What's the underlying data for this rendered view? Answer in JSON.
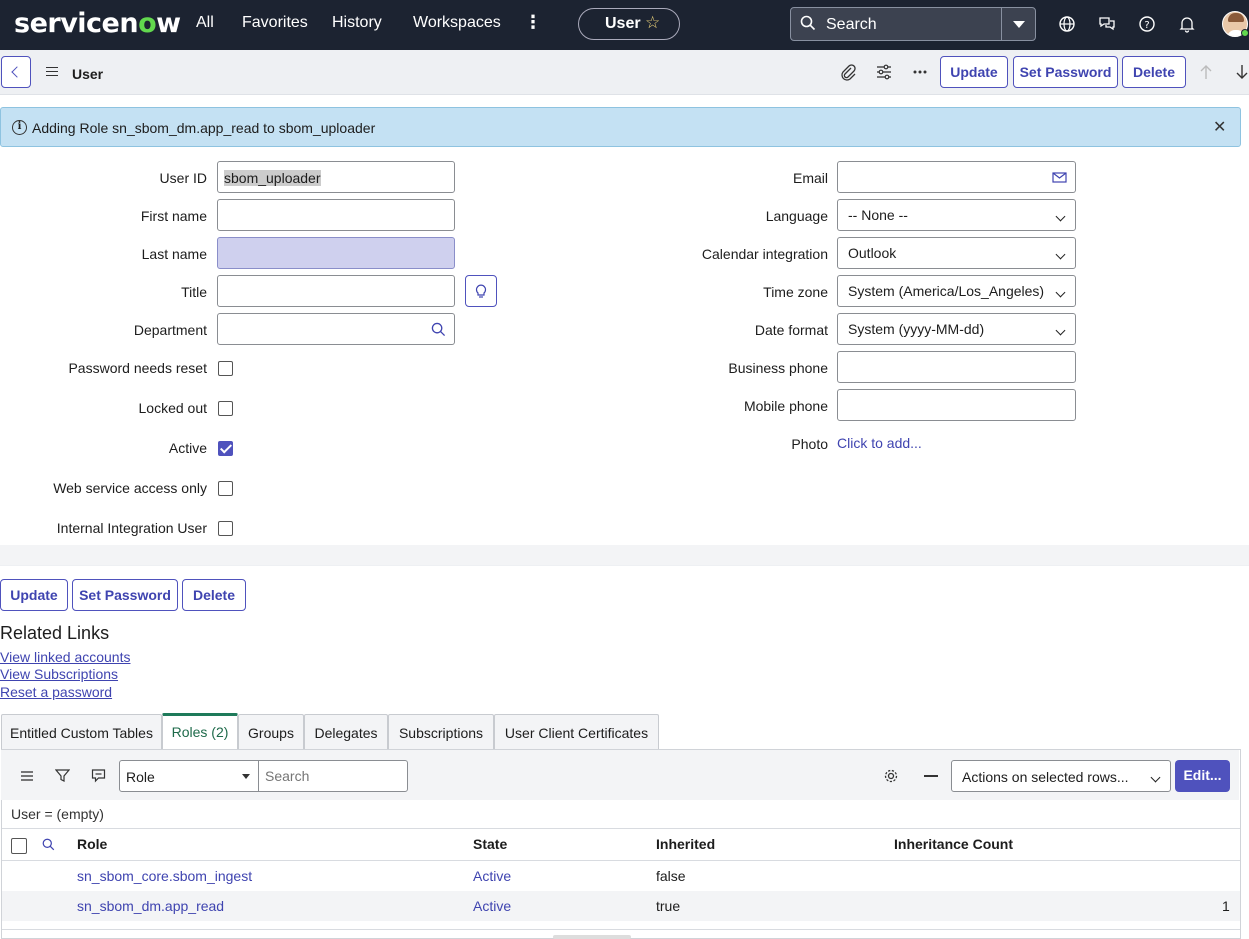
{
  "topnav": {
    "logo": "servicenow",
    "links": [
      "All",
      "Favorites",
      "History",
      "Workspaces"
    ],
    "context_label": "User",
    "search_label": "Search"
  },
  "header": {
    "title": "User",
    "buttons": [
      "Update",
      "Set Password",
      "Delete"
    ]
  },
  "banner": {
    "message": "Adding Role sn_sbom_dm.app_read to sbom_uploader"
  },
  "form": {
    "left": {
      "user_id_label": "User ID",
      "user_id_value": "sbom_uploader",
      "first_name_label": "First name",
      "first_name_value": "",
      "last_name_label": "Last name",
      "last_name_value": "",
      "title_label": "Title",
      "title_value": "",
      "department_label": "Department",
      "department_value": "",
      "password_reset_label": "Password needs reset",
      "locked_out_label": "Locked out",
      "active_label": "Active",
      "web_service_label": "Web service access only",
      "internal_integration_label": "Internal Integration User"
    },
    "right": {
      "email_label": "Email",
      "email_value": "",
      "language_label": "Language",
      "language_value": "-- None --",
      "calendar_label": "Calendar integration",
      "calendar_value": "Outlook",
      "timezone_label": "Time zone",
      "timezone_value": "System (America/Los_Angeles)",
      "date_format_label": "Date format",
      "date_format_value": "System (yyyy-MM-dd)",
      "business_phone_label": "Business phone",
      "business_phone_value": "",
      "mobile_phone_label": "Mobile phone",
      "mobile_phone_value": "",
      "photo_label": "Photo",
      "photo_link": "Click to add..."
    },
    "checkboxes": {
      "password_reset": false,
      "locked_out": false,
      "active": true,
      "web_service": false,
      "internal_integration": false
    }
  },
  "bottom_buttons": [
    "Update",
    "Set Password",
    "Delete"
  ],
  "related_links": {
    "title": "Related Links",
    "links": [
      "View linked accounts",
      "View Subscriptions",
      "Reset a password"
    ]
  },
  "tabs": [
    "Entitled Custom Tables",
    "Roles (2)",
    "Groups",
    "Delegates",
    "Subscriptions",
    "User Client Certificates"
  ],
  "list": {
    "search_field": "Role",
    "search_placeholder": "Search",
    "actions_select": "Actions on selected rows...",
    "edit_button": "Edit...",
    "query": "User = (empty)",
    "columns": [
      "Role",
      "State",
      "Inherited",
      "Inheritance Count"
    ],
    "rows": [
      {
        "role": "sn_sbom_core.sbom_ingest",
        "state": "Active",
        "inherited": "false",
        "count": ""
      },
      {
        "role": "sn_sbom_dm.app_read",
        "state": "Active",
        "inherited": "true",
        "count": "1"
      }
    ]
  },
  "colors": {
    "nav_bg": "#1c2331",
    "accent": "#4f52bd",
    "banner_bg": "#c4e1f3",
    "active_tab": "#1e7a5a"
  }
}
